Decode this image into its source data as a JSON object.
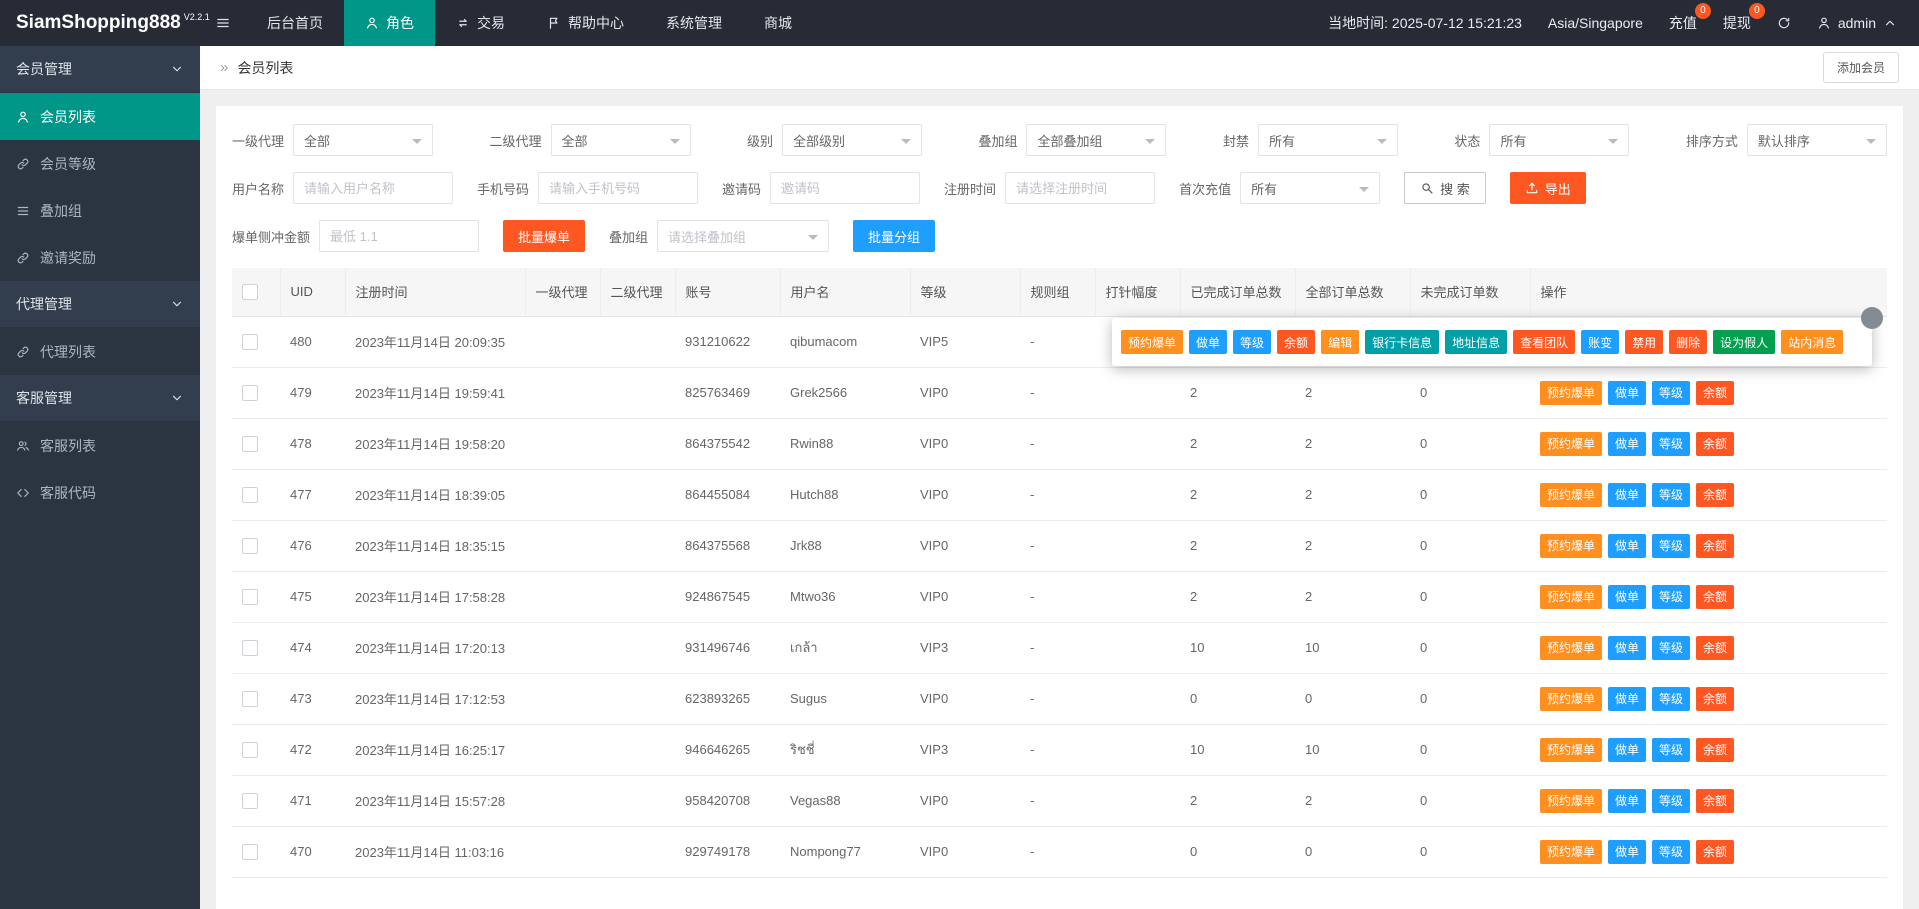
{
  "palette": {
    "topbar_bg": "#262b36",
    "sidebar_bg": "#2b3542",
    "active_green": "#009688",
    "orange": "#ff8f1f",
    "blue": "#1e9fff",
    "red": "#ff5722",
    "teal": "#00a0a8",
    "green": "#00a04e"
  },
  "topbar": {
    "logo": "SiamShopping888",
    "logo_version": "V2.2.1",
    "menu": [
      {
        "key": "home",
        "label": "后台首页",
        "icon": "",
        "active": false
      },
      {
        "key": "role",
        "label": "角色",
        "icon": "person",
        "active": true
      },
      {
        "key": "trade",
        "label": "交易",
        "icon": "exchange",
        "active": false
      },
      {
        "key": "help-center",
        "label": "帮助中心",
        "icon": "flag",
        "active": false
      },
      {
        "key": "system",
        "label": "系统管理",
        "icon": "",
        "active": false
      },
      {
        "key": "mall",
        "label": "商城",
        "icon": "",
        "active": false
      }
    ],
    "local_time": "当地时间: 2025-07-12 15:21:23",
    "timezone": "Asia/Singapore",
    "recharge": {
      "label": "充值",
      "badge": "0"
    },
    "withdraw": {
      "label": "提现",
      "badge": "0"
    },
    "admin_label": "admin"
  },
  "sidebar": {
    "groups": [
      {
        "key": "member-management",
        "label": "会员管理",
        "items": [
          {
            "key": "member-list",
            "label": "会员列表",
            "icon": "person",
            "active": true
          },
          {
            "key": "member-level",
            "label": "会员等级",
            "icon": "link",
            "active": false
          },
          {
            "key": "overlay-group",
            "label": "叠加组",
            "icon": "list",
            "active": false
          },
          {
            "key": "invite-reward",
            "label": "邀请奖励",
            "icon": "link",
            "active": false
          }
        ]
      },
      {
        "key": "agent-management",
        "label": "代理管理",
        "items": [
          {
            "key": "agent-list",
            "label": "代理列表",
            "icon": "link",
            "active": false
          }
        ]
      },
      {
        "key": "service-management",
        "label": "客服管理",
        "items": [
          {
            "key": "service-list",
            "label": "客服列表",
            "icon": "people",
            "active": false
          },
          {
            "key": "service-code",
            "label": "客服代码",
            "icon": "code",
            "active": false
          }
        ]
      }
    ]
  },
  "breadcrumb": {
    "marker": "»",
    "title": "会员列表",
    "add_member_button": "添加会员"
  },
  "filters": {
    "selects": [
      {
        "key": "agent1",
        "label": "一级代理",
        "value": "全部"
      },
      {
        "key": "agent2",
        "label": "二级代理",
        "value": "全部"
      },
      {
        "key": "level",
        "label": "级别",
        "value": "全部级别"
      },
      {
        "key": "overlay-group",
        "label": "叠加组",
        "value": "全部叠加组"
      },
      {
        "key": "ban",
        "label": "封禁",
        "value": "所有"
      },
      {
        "key": "status",
        "label": "状态",
        "value": "所有"
      },
      {
        "key": "sort",
        "label": "排序方式",
        "value": "默认排序"
      }
    ],
    "inputs": [
      {
        "key": "username",
        "label": "用户名称",
        "placeholder": "请输入用户名称"
      },
      {
        "key": "phone",
        "label": "手机号码",
        "placeholder": "请输入手机号码"
      },
      {
        "key": "invite-code",
        "label": "邀请码",
        "placeholder": "邀请码"
      },
      {
        "key": "reg-time",
        "label": "注册时间",
        "placeholder": "请选择注册时间"
      }
    ],
    "first_recharge": {
      "label": "首次充值",
      "value": "所有"
    },
    "search_button": "搜 索",
    "export_button": "导出",
    "burst_amount": {
      "label": "爆单侧冲金额",
      "placeholder": "最低 1.1"
    },
    "bulk_burst_button": "批量爆单",
    "overlay_pick": {
      "label": "叠加组",
      "placeholder": "请选择叠加组"
    },
    "bulk_group_button": "批量分组"
  },
  "table": {
    "columns": [
      "",
      "UID",
      "注册时间",
      "一级代理",
      "二级代理",
      "账号",
      "用户名",
      "等级",
      "规则组",
      "打针幅度",
      "已完成订单总数",
      "全部订单总数",
      "未完成订单数",
      "操作"
    ],
    "row_actions": [
      {
        "label": "预约爆单",
        "color": "orange"
      },
      {
        "label": "做单",
        "color": "blue"
      },
      {
        "label": "等级",
        "color": "blue"
      },
      {
        "label": "余额",
        "color": "red"
      }
    ],
    "rows": [
      {
        "uid": "480",
        "reg_time": "2023年11月14日 20:09:35",
        "agent1": "",
        "agent2": "",
        "account": "931210622",
        "username": "qibumacom",
        "level": "VIP5",
        "rule_group": "-",
        "needle": "",
        "done_orders": "",
        "total_orders": "",
        "undone_orders": ""
      },
      {
        "uid": "479",
        "reg_time": "2023年11月14日 19:59:41",
        "agent1": "",
        "agent2": "",
        "account": "825763469",
        "username": "Grek2566",
        "level": "VIP0",
        "rule_group": "-",
        "needle": "",
        "done_orders": "2",
        "total_orders": "2",
        "undone_orders": "0"
      },
      {
        "uid": "478",
        "reg_time": "2023年11月14日 19:58:20",
        "agent1": "",
        "agent2": "",
        "account": "864375542",
        "username": "Rwin88",
        "level": "VIP0",
        "rule_group": "-",
        "needle": "",
        "done_orders": "2",
        "total_orders": "2",
        "undone_orders": "0"
      },
      {
        "uid": "477",
        "reg_time": "2023年11月14日 18:39:05",
        "agent1": "",
        "agent2": "",
        "account": "864455084",
        "username": "Hutch88",
        "level": "VIP0",
        "rule_group": "-",
        "needle": "",
        "done_orders": "2",
        "total_orders": "2",
        "undone_orders": "0"
      },
      {
        "uid": "476",
        "reg_time": "2023年11月14日 18:35:15",
        "agent1": "",
        "agent2": "",
        "account": "864375568",
        "username": "Jrk88",
        "level": "VIP0",
        "rule_group": "-",
        "needle": "",
        "done_orders": "2",
        "total_orders": "2",
        "undone_orders": "0"
      },
      {
        "uid": "475",
        "reg_time": "2023年11月14日 17:58:28",
        "agent1": "",
        "agent2": "",
        "account": "924867545",
        "username": "Mtwo36",
        "level": "VIP0",
        "rule_group": "-",
        "needle": "",
        "done_orders": "2",
        "total_orders": "2",
        "undone_orders": "0"
      },
      {
        "uid": "474",
        "reg_time": "2023年11月14日 17:20:13",
        "agent1": "",
        "agent2": "",
        "account": "931496746",
        "username": "เกล้า",
        "level": "VIP3",
        "rule_group": "-",
        "needle": "",
        "done_orders": "10",
        "total_orders": "10",
        "undone_orders": "0"
      },
      {
        "uid": "473",
        "reg_time": "2023年11月14日 17:12:53",
        "agent1": "",
        "agent2": "",
        "account": "623893265",
        "username": "Sugus",
        "level": "VIP0",
        "rule_group": "-",
        "needle": "",
        "done_orders": "0",
        "total_orders": "0",
        "undone_orders": "0"
      },
      {
        "uid": "472",
        "reg_time": "2023年11月14日 16:25:17",
        "agent1": "",
        "agent2": "",
        "account": "946646265",
        "username": "ริชชี่",
        "level": "VIP3",
        "rule_group": "-",
        "needle": "",
        "done_orders": "10",
        "total_orders": "10",
        "undone_orders": "0"
      },
      {
        "uid": "471",
        "reg_time": "2023年11月14日 15:57:28",
        "agent1": "",
        "agent2": "",
        "account": "958420708",
        "username": "Vegas88",
        "level": "VIP0",
        "rule_group": "-",
        "needle": "",
        "done_orders": "2",
        "total_orders": "2",
        "undone_orders": "0"
      },
      {
        "uid": "470",
        "reg_time": "2023年11月14日 11:03:16",
        "agent1": "",
        "agent2": "",
        "account": "929749178",
        "username": "Nompong77",
        "level": "VIP0",
        "rule_group": "-",
        "needle": "",
        "done_orders": "0",
        "total_orders": "0",
        "undone_orders": "0"
      }
    ]
  },
  "popup": {
    "buttons": [
      {
        "label": "预约爆单",
        "color": "orange"
      },
      {
        "label": "做单",
        "color": "blue"
      },
      {
        "label": "等级",
        "color": "blue"
      },
      {
        "label": "余额",
        "color": "red"
      },
      {
        "label": "编辑",
        "color": "orange"
      },
      {
        "label": "银行卡信息",
        "color": "teal"
      },
      {
        "label": "地址信息",
        "color": "teal"
      },
      {
        "label": "查看团队",
        "color": "red"
      },
      {
        "label": "账变",
        "color": "blue"
      },
      {
        "label": "禁用",
        "color": "red"
      },
      {
        "label": "删除",
        "color": "red"
      },
      {
        "label": "设为假人",
        "color": "green"
      },
      {
        "label": "站内消息",
        "color": "orange"
      }
    ]
  }
}
